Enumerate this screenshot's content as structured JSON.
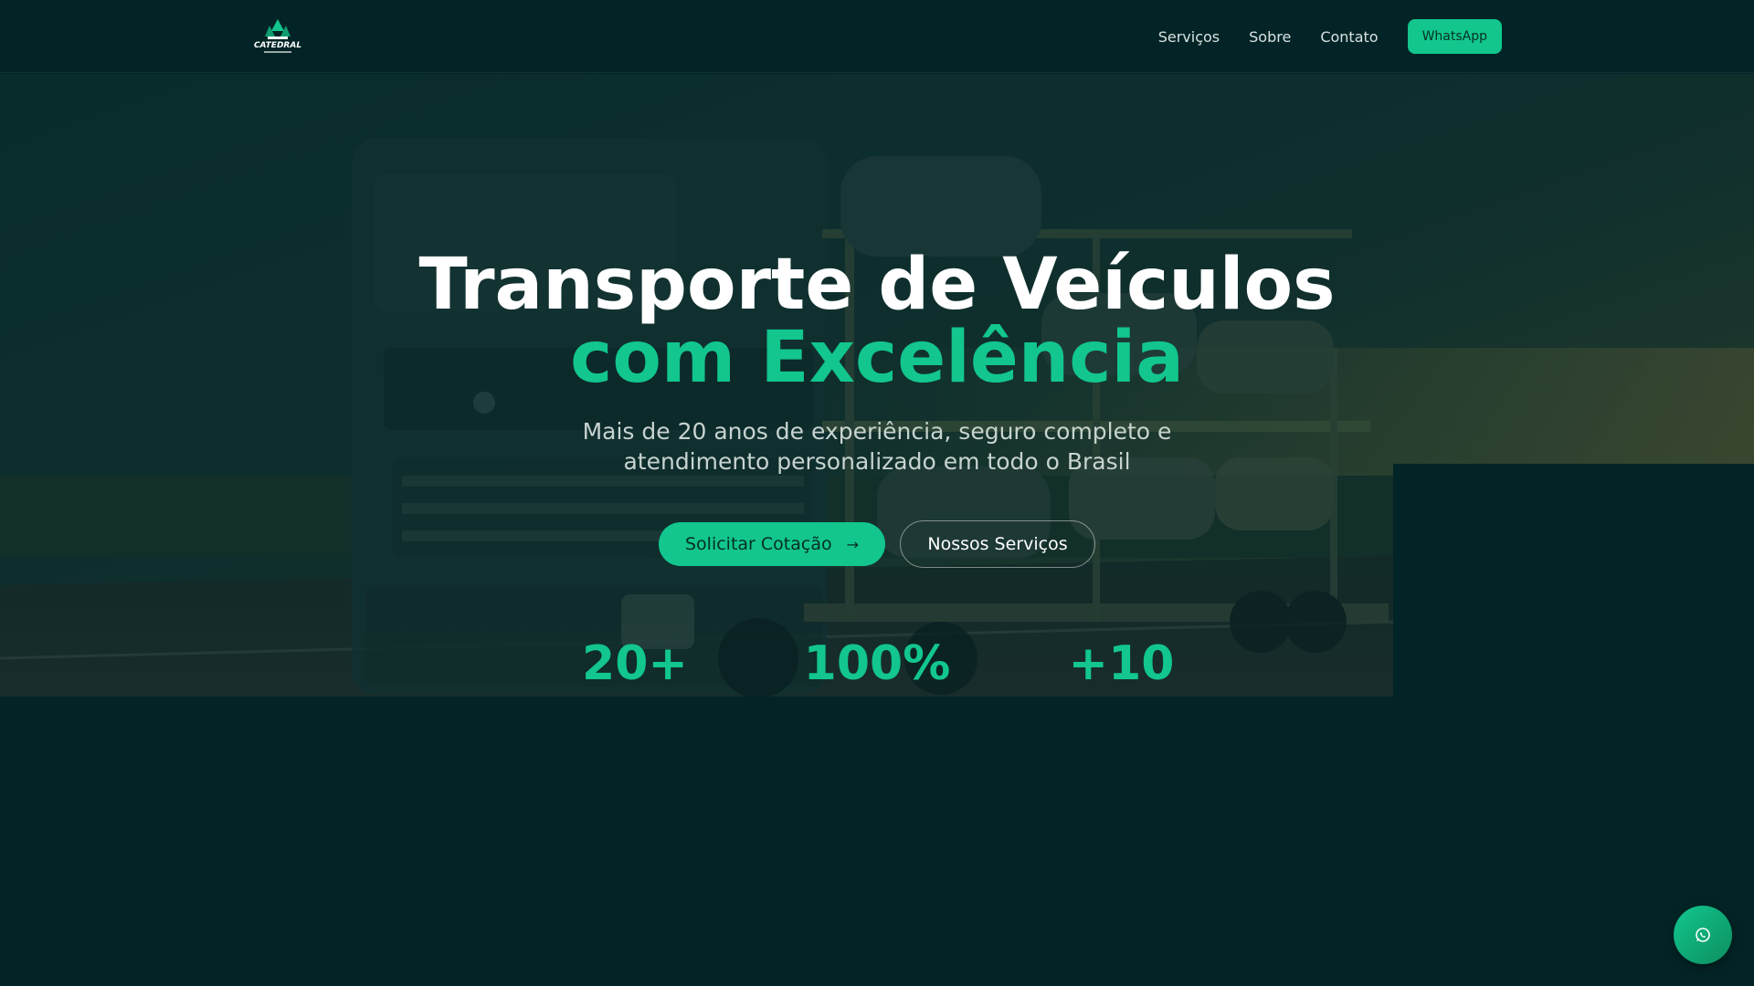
{
  "header": {
    "logo_text": "CATEDRAL",
    "nav": [
      {
        "label": "Serviços"
      },
      {
        "label": "Sobre"
      },
      {
        "label": "Contato"
      }
    ],
    "whatsapp_label": "WhatsApp"
  },
  "hero": {
    "title_line1": "Transporte de Veículos",
    "title_line2": "com Excelência",
    "subtitle": "Mais de 20 anos de experiência, seguro completo e atendimento personalizado em todo o Brasil",
    "primary_button": "Solicitar Cotação",
    "primary_button_icon": "arrow-right-icon",
    "secondary_button": "Nossos Serviços",
    "stats": [
      {
        "value": "20+"
      },
      {
        "value": "100%"
      },
      {
        "value": "+10"
      }
    ]
  },
  "floating_button_icon": "whatsapp-icon",
  "colors": {
    "background": "#032426",
    "accent": "#12c68e",
    "title": "#ffffff",
    "subtitle": "#c7d3cf"
  }
}
